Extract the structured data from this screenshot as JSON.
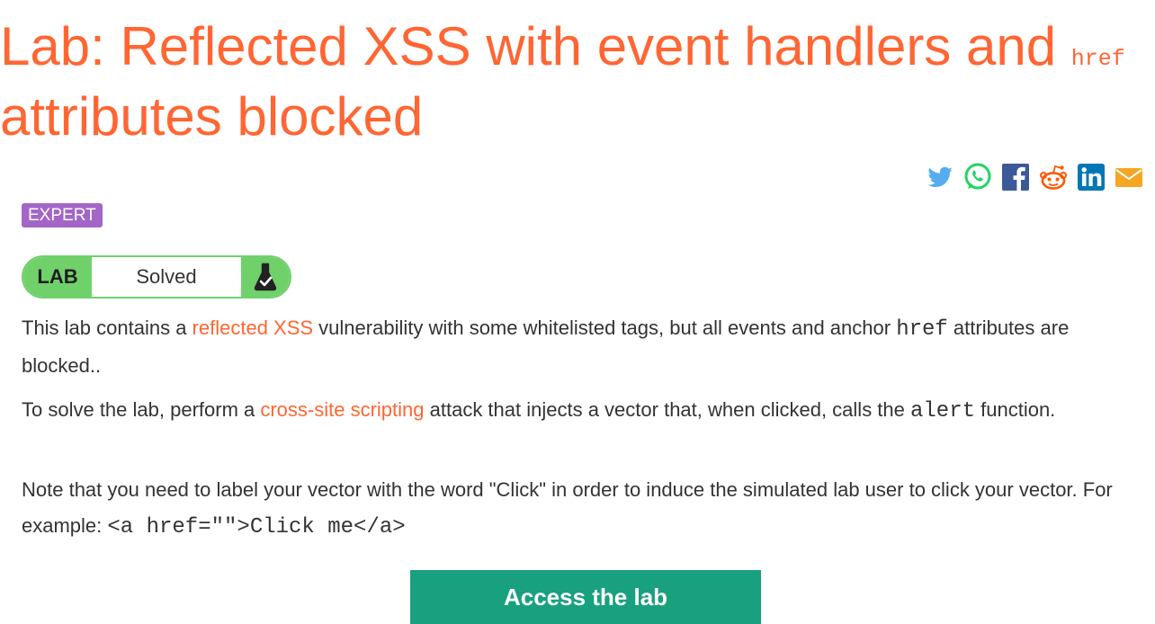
{
  "title": {
    "text_before": "Lab: Reflected XSS with event handlers and ",
    "code": "href",
    "text_after": " attributes blocked"
  },
  "share_icons": [
    "twitter-icon",
    "whatsapp-icon",
    "facebook-icon",
    "reddit-icon",
    "linkedin-icon",
    "email-icon"
  ],
  "difficulty_badge": "EXPERT",
  "lab_status": {
    "tag": "LAB",
    "state": "Solved",
    "icon": "flask-check-icon"
  },
  "description": {
    "p1": {
      "t1": "This lab contains a ",
      "link": "reflected XSS",
      "t2": " vulnerability with some whitelisted tags, but all events and anchor ",
      "code": "href",
      "t3": " attributes are blocked.."
    },
    "p2": {
      "t1": "To solve the lab, perform a ",
      "link": "cross-site scripting",
      "t2": " attack that injects a vector that, when clicked, calls the ",
      "code": "alert",
      "t3": " function."
    },
    "p3": {
      "t1": "Note that you need to label your vector with the word \"Click\" in order to induce the simulated lab user to click your vector. For example: ",
      "code": "<a href=\"\">Click me</a>"
    }
  },
  "access_button": "Access the lab",
  "colors": {
    "accent": "#ff6633",
    "expert_badge": "#a366c7",
    "solved_green": "#70d16b",
    "button_green": "#19a07f"
  }
}
